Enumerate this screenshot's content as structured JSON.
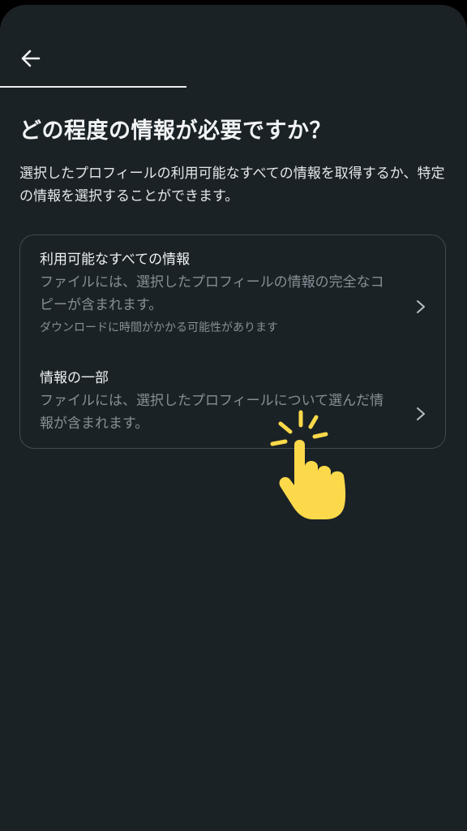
{
  "header": {
    "back_icon": "arrow-left-icon",
    "progress_fraction": 0.4
  },
  "page": {
    "title": "どの程度の情報が必要ですか？",
    "description": "選択したプロフィールの利用可能なすべての情報を取得するか、特定の情報を選択することができます。"
  },
  "options": [
    {
      "title": "利用可能なすべての情報",
      "description": "ファイルには、選択したプロフィールの情報の完全なコピーが含まれます。",
      "note": "ダウンロードに時間がかかる可能性があります",
      "icon": "chevron-right-icon"
    },
    {
      "title": "情報の一部",
      "description": "ファイルには、選択したプロフィールについて選んだ情報が含まれます。",
      "icon": "chevron-right-icon"
    }
  ],
  "overlay": {
    "icon": "tapping-hand-icon",
    "color": "#fbd94a"
  },
  "colors": {
    "background": "#1b2226",
    "text_primary": "#eef1f2",
    "text_secondary": "#858f95",
    "border": "#3e4a51"
  }
}
